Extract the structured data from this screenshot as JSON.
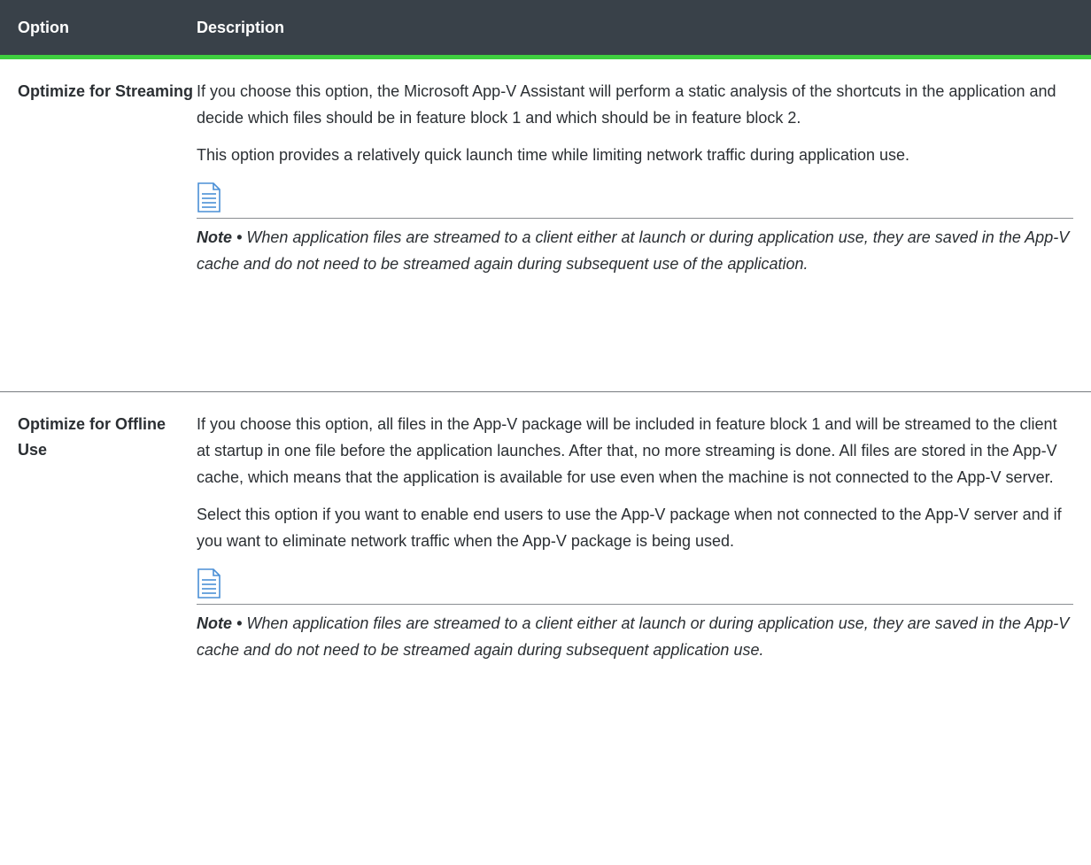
{
  "table": {
    "headers": {
      "option": "Option",
      "description": "Description"
    },
    "rows": [
      {
        "option": "Optimize for Streaming",
        "paragraphs": [
          "If you choose this option, the Microsoft App-V Assistant will perform a static analysis of the shortcuts in the application and decide which files should be in feature block 1 and which should be in feature block 2.",
          "This option provides a relatively quick launch time while limiting network traffic during application use."
        ],
        "note_icon": "document-note-icon",
        "note_label": "Note •",
        "note_text": "When application files are streamed to a client either at launch or during application use, they are saved in the App-V cache and do not need to be streamed again during subsequent use of the application."
      },
      {
        "option": "Optimize for Offline Use",
        "paragraphs": [
          "If you choose this option, all files in the App-V package will be included in feature block 1 and will be streamed to the client at startup in one file before the application launches. After that, no more streaming is done. All files are stored in the App-V cache, which means that the application is available for use even when the machine is not connected to the App-V server.",
          "Select this option if you want to enable end users to use the App-V package when not connected to the App-V server and if you want to eliminate network traffic when the App-V package is being used."
        ],
        "note_icon": "document-note-icon",
        "note_label": "Note •",
        "note_text": "When application files are streamed to a client either at launch or during application use, they are saved in the App-V cache and do not need to be streamed again during subsequent application use."
      }
    ]
  },
  "colors": {
    "header_bg": "#394149",
    "header_accent": "#3fcf3f",
    "icon_line": "#4a8fd6"
  }
}
